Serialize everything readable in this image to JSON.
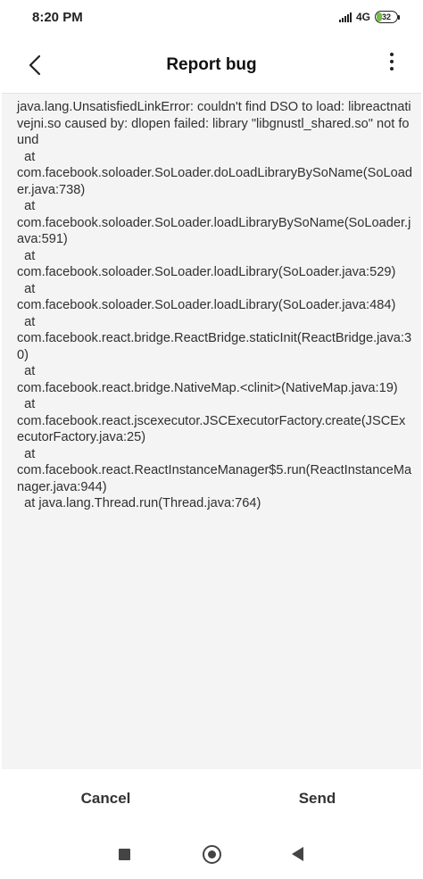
{
  "status_bar": {
    "time": "8:20 PM",
    "network": "4G",
    "battery_level": "32",
    "battery_color": "#74c043"
  },
  "header": {
    "title": "Report bug",
    "back_icon": "chevron-left-icon",
    "more_icon": "more-vertical-icon"
  },
  "report": {
    "text": "java.lang.UnsatisfiedLinkError: couldn't find DSO to load: libreactnativejni.so caused by: dlopen failed: library \"libgnustl_shared.so\" not found\n  at\ncom.facebook.soloader.SoLoader.doLoadLibraryBySoName(SoLoader.java:738)\n  at\ncom.facebook.soloader.SoLoader.loadLibraryBySoName(SoLoader.java:591)\n  at\ncom.facebook.soloader.SoLoader.loadLibrary(SoLoader.java:529)\n  at\ncom.facebook.soloader.SoLoader.loadLibrary(SoLoader.java:484)\n  at\ncom.facebook.react.bridge.ReactBridge.staticInit(ReactBridge.java:30)\n  at\ncom.facebook.react.bridge.NativeMap.<clinit>(NativeMap.java:19)\n  at\ncom.facebook.react.jscexecutor.JSCExecutorFactory.create(JSCExecutorFactory.java:25)\n  at\ncom.facebook.react.ReactInstanceManager$5.run(ReactInstanceManager.java:944)\n  at java.lang.Thread.run(Thread.java:764)"
  },
  "actions": {
    "cancel_label": "Cancel",
    "send_label": "Send"
  },
  "nav": {
    "recents_icon": "square-icon",
    "home_icon": "circle-home-icon",
    "back_icon": "triangle-back-icon"
  }
}
